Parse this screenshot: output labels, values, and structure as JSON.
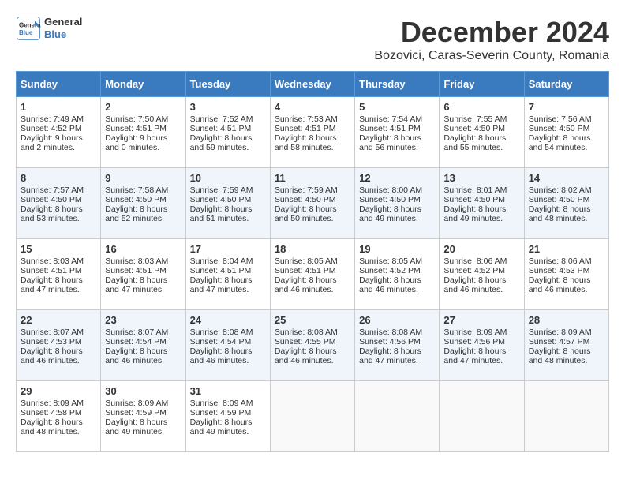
{
  "header": {
    "logo_line1": "General",
    "logo_line2": "Blue",
    "month_title": "December 2024",
    "subtitle": "Bozovici, Caras-Severin County, Romania"
  },
  "days_of_week": [
    "Sunday",
    "Monday",
    "Tuesday",
    "Wednesday",
    "Thursday",
    "Friday",
    "Saturday"
  ],
  "weeks": [
    [
      {
        "day": 1,
        "sunrise": "Sunrise: 7:49 AM",
        "sunset": "Sunset: 4:52 PM",
        "daylight": "Daylight: 9 hours and 2 minutes."
      },
      {
        "day": 2,
        "sunrise": "Sunrise: 7:50 AM",
        "sunset": "Sunset: 4:51 PM",
        "daylight": "Daylight: 9 hours and 0 minutes."
      },
      {
        "day": 3,
        "sunrise": "Sunrise: 7:52 AM",
        "sunset": "Sunset: 4:51 PM",
        "daylight": "Daylight: 8 hours and 59 minutes."
      },
      {
        "day": 4,
        "sunrise": "Sunrise: 7:53 AM",
        "sunset": "Sunset: 4:51 PM",
        "daylight": "Daylight: 8 hours and 58 minutes."
      },
      {
        "day": 5,
        "sunrise": "Sunrise: 7:54 AM",
        "sunset": "Sunset: 4:51 PM",
        "daylight": "Daylight: 8 hours and 56 minutes."
      },
      {
        "day": 6,
        "sunrise": "Sunrise: 7:55 AM",
        "sunset": "Sunset: 4:50 PM",
        "daylight": "Daylight: 8 hours and 55 minutes."
      },
      {
        "day": 7,
        "sunrise": "Sunrise: 7:56 AM",
        "sunset": "Sunset: 4:50 PM",
        "daylight": "Daylight: 8 hours and 54 minutes."
      }
    ],
    [
      {
        "day": 8,
        "sunrise": "Sunrise: 7:57 AM",
        "sunset": "Sunset: 4:50 PM",
        "daylight": "Daylight: 8 hours and 53 minutes."
      },
      {
        "day": 9,
        "sunrise": "Sunrise: 7:58 AM",
        "sunset": "Sunset: 4:50 PM",
        "daylight": "Daylight: 8 hours and 52 minutes."
      },
      {
        "day": 10,
        "sunrise": "Sunrise: 7:59 AM",
        "sunset": "Sunset: 4:50 PM",
        "daylight": "Daylight: 8 hours and 51 minutes."
      },
      {
        "day": 11,
        "sunrise": "Sunrise: 7:59 AM",
        "sunset": "Sunset: 4:50 PM",
        "daylight": "Daylight: 8 hours and 50 minutes."
      },
      {
        "day": 12,
        "sunrise": "Sunrise: 8:00 AM",
        "sunset": "Sunset: 4:50 PM",
        "daylight": "Daylight: 8 hours and 49 minutes."
      },
      {
        "day": 13,
        "sunrise": "Sunrise: 8:01 AM",
        "sunset": "Sunset: 4:50 PM",
        "daylight": "Daylight: 8 hours and 49 minutes."
      },
      {
        "day": 14,
        "sunrise": "Sunrise: 8:02 AM",
        "sunset": "Sunset: 4:50 PM",
        "daylight": "Daylight: 8 hours and 48 minutes."
      }
    ],
    [
      {
        "day": 15,
        "sunrise": "Sunrise: 8:03 AM",
        "sunset": "Sunset: 4:51 PM",
        "daylight": "Daylight: 8 hours and 47 minutes."
      },
      {
        "day": 16,
        "sunrise": "Sunrise: 8:03 AM",
        "sunset": "Sunset: 4:51 PM",
        "daylight": "Daylight: 8 hours and 47 minutes."
      },
      {
        "day": 17,
        "sunrise": "Sunrise: 8:04 AM",
        "sunset": "Sunset: 4:51 PM",
        "daylight": "Daylight: 8 hours and 47 minutes."
      },
      {
        "day": 18,
        "sunrise": "Sunrise: 8:05 AM",
        "sunset": "Sunset: 4:51 PM",
        "daylight": "Daylight: 8 hours and 46 minutes."
      },
      {
        "day": 19,
        "sunrise": "Sunrise: 8:05 AM",
        "sunset": "Sunset: 4:52 PM",
        "daylight": "Daylight: 8 hours and 46 minutes."
      },
      {
        "day": 20,
        "sunrise": "Sunrise: 8:06 AM",
        "sunset": "Sunset: 4:52 PM",
        "daylight": "Daylight: 8 hours and 46 minutes."
      },
      {
        "day": 21,
        "sunrise": "Sunrise: 8:06 AM",
        "sunset": "Sunset: 4:53 PM",
        "daylight": "Daylight: 8 hours and 46 minutes."
      }
    ],
    [
      {
        "day": 22,
        "sunrise": "Sunrise: 8:07 AM",
        "sunset": "Sunset: 4:53 PM",
        "daylight": "Daylight: 8 hours and 46 minutes."
      },
      {
        "day": 23,
        "sunrise": "Sunrise: 8:07 AM",
        "sunset": "Sunset: 4:54 PM",
        "daylight": "Daylight: 8 hours and 46 minutes."
      },
      {
        "day": 24,
        "sunrise": "Sunrise: 8:08 AM",
        "sunset": "Sunset: 4:54 PM",
        "daylight": "Daylight: 8 hours and 46 minutes."
      },
      {
        "day": 25,
        "sunrise": "Sunrise: 8:08 AM",
        "sunset": "Sunset: 4:55 PM",
        "daylight": "Daylight: 8 hours and 46 minutes."
      },
      {
        "day": 26,
        "sunrise": "Sunrise: 8:08 AM",
        "sunset": "Sunset: 4:56 PM",
        "daylight": "Daylight: 8 hours and 47 minutes."
      },
      {
        "day": 27,
        "sunrise": "Sunrise: 8:09 AM",
        "sunset": "Sunset: 4:56 PM",
        "daylight": "Daylight: 8 hours and 47 minutes."
      },
      {
        "day": 28,
        "sunrise": "Sunrise: 8:09 AM",
        "sunset": "Sunset: 4:57 PM",
        "daylight": "Daylight: 8 hours and 48 minutes."
      }
    ],
    [
      {
        "day": 29,
        "sunrise": "Sunrise: 8:09 AM",
        "sunset": "Sunset: 4:58 PM",
        "daylight": "Daylight: 8 hours and 48 minutes."
      },
      {
        "day": 30,
        "sunrise": "Sunrise: 8:09 AM",
        "sunset": "Sunset: 4:59 PM",
        "daylight": "Daylight: 8 hours and 49 minutes."
      },
      {
        "day": 31,
        "sunrise": "Sunrise: 8:09 AM",
        "sunset": "Sunset: 4:59 PM",
        "daylight": "Daylight: 8 hours and 49 minutes."
      },
      null,
      null,
      null,
      null
    ]
  ]
}
